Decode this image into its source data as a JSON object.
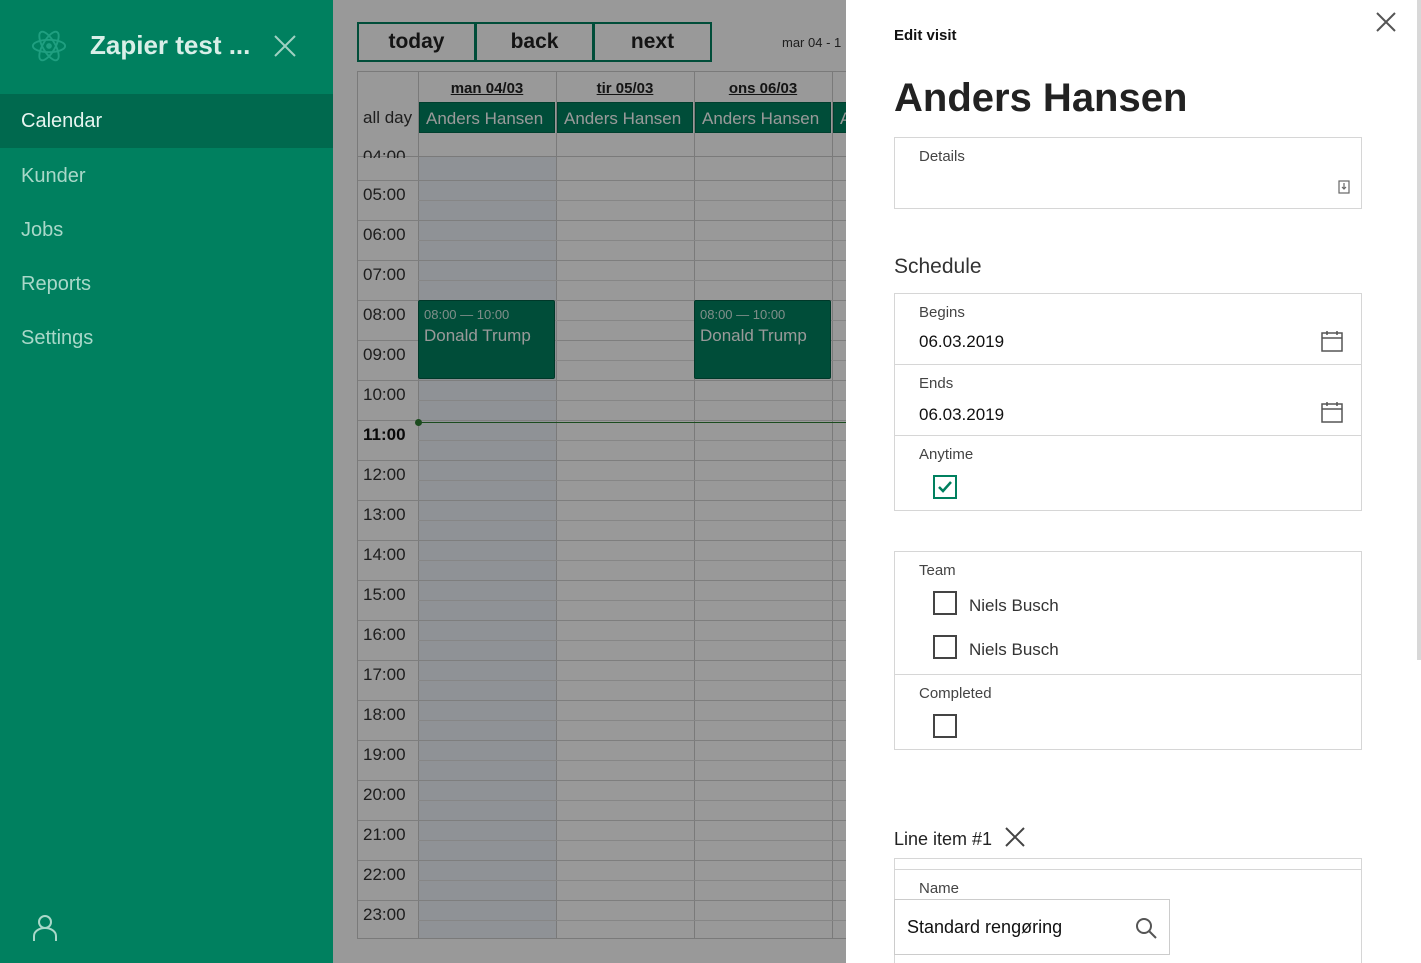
{
  "sidebar": {
    "title": "Zapier test ...",
    "nav": [
      {
        "label": "Calendar",
        "active": true
      },
      {
        "label": "Kunder",
        "active": false
      },
      {
        "label": "Jobs",
        "active": false
      },
      {
        "label": "Reports",
        "active": false
      },
      {
        "label": "Settings",
        "active": false
      }
    ]
  },
  "calendar": {
    "buttons": {
      "today": "today",
      "back": "back",
      "next": "next"
    },
    "range": "mar 04 - 1",
    "all_day_label": "all day",
    "days": [
      "man 04/03",
      "tir 05/03",
      "ons 06/03"
    ],
    "all_day_events": [
      "Anders Hansen",
      "Anders Hansen",
      "Anders Hansen",
      "A"
    ],
    "partial_top_label": "04:00",
    "hours": [
      "05:00",
      "06:00",
      "07:00",
      "08:00",
      "09:00",
      "10:00",
      "11:00",
      "12:00",
      "13:00",
      "14:00",
      "15:00",
      "16:00",
      "17:00",
      "18:00",
      "19:00",
      "20:00",
      "21:00",
      "22:00",
      "23:00"
    ],
    "current_hour": "11:00",
    "events": [
      {
        "day": "man 04/03",
        "time": "08:00 — 10:00",
        "title": "Donald Trump"
      },
      {
        "day": "ons 06/03",
        "time": "08:00 — 10:00",
        "title": "Donald Trump"
      }
    ]
  },
  "panel": {
    "subtitle": "Edit visit",
    "title": "Anders Hansen",
    "details_label": "Details",
    "schedule_title": "Schedule",
    "begins_label": "Begins",
    "begins_value": "06.03.2019",
    "ends_label": "Ends",
    "ends_value": "06.03.2019",
    "anytime_label": "Anytime",
    "anytime_checked": true,
    "team_label": "Team",
    "team_members": [
      {
        "name": "Niels Busch",
        "checked": false
      },
      {
        "name": "Niels Busch",
        "checked": false
      }
    ],
    "completed_label": "Completed",
    "completed_checked": false,
    "line_item_title": "Line item #1",
    "name_label": "Name",
    "name_value": "Standard rengøring"
  },
  "colors": {
    "brand": "#00805f",
    "brand_dark": "#00694e"
  }
}
